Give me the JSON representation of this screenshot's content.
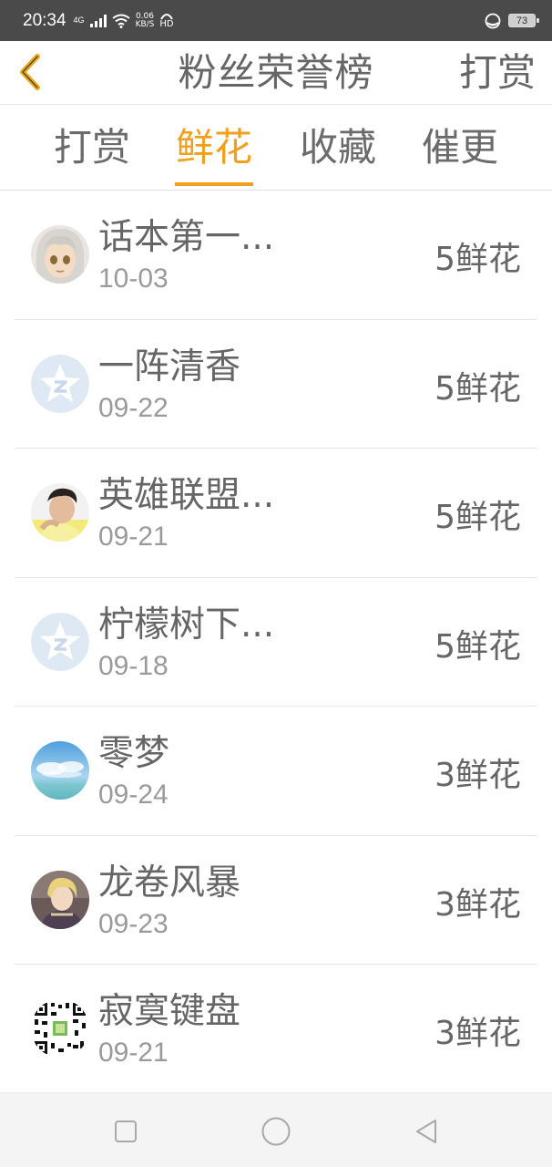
{
  "status_bar": {
    "time": "20:34",
    "network": "4G",
    "speed_value": "0.06",
    "speed_unit": "KB/S",
    "hd": "HD",
    "battery": "73"
  },
  "header": {
    "title": "粉丝荣誉榜",
    "action_label": "打赏",
    "back_icon": "chevron-left-icon"
  },
  "tabs": [
    {
      "label": "打赏",
      "active": false
    },
    {
      "label": "鲜花",
      "active": true
    },
    {
      "label": "收藏",
      "active": false
    },
    {
      "label": "催更",
      "active": false
    }
  ],
  "list": [
    {
      "name": "话本第一...",
      "date": "10-03",
      "amount": "5鲜花",
      "avatar": "anime-girl-avatar"
    },
    {
      "name": "一阵清香",
      "date": "09-22",
      "amount": "5鲜花",
      "avatar": "default-star-avatar"
    },
    {
      "name": "英雄联盟...",
      "date": "09-21",
      "amount": "5鲜花",
      "avatar": "man-photo-avatar"
    },
    {
      "name": "柠檬树下...",
      "date": "09-18",
      "amount": "5鲜花",
      "avatar": "default-star-avatar"
    },
    {
      "name": "零梦",
      "date": "09-24",
      "amount": "3鲜花",
      "avatar": "sky-photo-avatar"
    },
    {
      "name": "龙卷风暴",
      "date": "09-23",
      "amount": "3鲜花",
      "avatar": "anime-boy-avatar"
    },
    {
      "name": "寂寞键盘",
      "date": "09-21",
      "amount": "3鲜花",
      "avatar": "qr-code-avatar"
    }
  ],
  "colors": {
    "accent": "#f0a01c",
    "text": "#666666",
    "subtext": "#9a9a9a",
    "status_bar": "#4a4a4a"
  }
}
